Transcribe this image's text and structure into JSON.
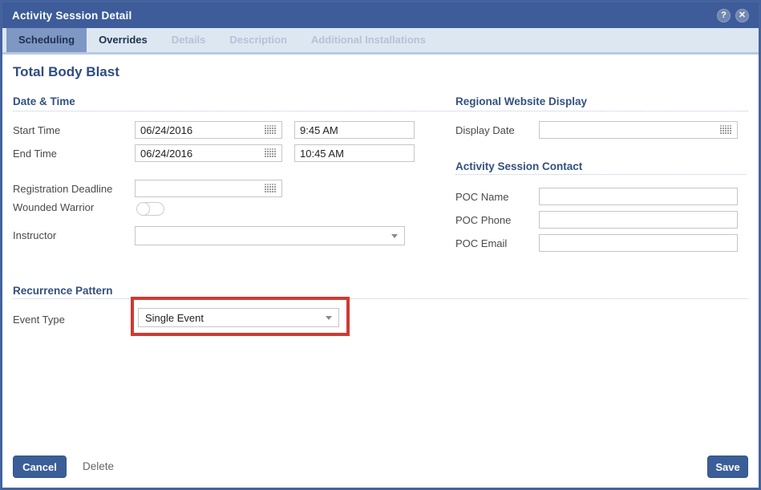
{
  "titlebar": {
    "title": "Activity Session Detail",
    "help_glyph": "?",
    "close_glyph": "✕"
  },
  "tabs": [
    {
      "label": "Scheduling",
      "state": "active"
    },
    {
      "label": "Overrides",
      "state": "enabled"
    },
    {
      "label": "Details",
      "state": "disabled"
    },
    {
      "label": "Description",
      "state": "disabled"
    },
    {
      "label": "Additional Installations",
      "state": "disabled"
    }
  ],
  "content": {
    "heading": "Total Body Blast",
    "sections": {
      "date_time": {
        "title": "Date & Time"
      },
      "regional": {
        "title": "Regional Website Display"
      },
      "contact": {
        "title": "Activity Session Contact"
      },
      "recurrence": {
        "title": "Recurrence Pattern"
      }
    },
    "fields": {
      "start_time": {
        "label": "Start Time",
        "date": "06/24/2016",
        "time": "9:45 AM"
      },
      "end_time": {
        "label": "End Time",
        "date": "06/24/2016",
        "time": "10:45 AM"
      },
      "registration_deadline": {
        "label": "Registration Deadline",
        "date": ""
      },
      "wounded_warrior": {
        "label": "Wounded Warrior",
        "state": "off"
      },
      "instructor": {
        "label": "Instructor",
        "value": ""
      },
      "display_date": {
        "label": "Display Date",
        "date": ""
      },
      "poc_name": {
        "label": "POC Name",
        "value": ""
      },
      "poc_phone": {
        "label": "POC Phone",
        "value": ""
      },
      "poc_email": {
        "label": "POC Email",
        "value": ""
      },
      "event_type": {
        "label": "Event Type",
        "value": "Single Event"
      }
    }
  },
  "footer": {
    "cancel_label": "Cancel",
    "delete_label": "Delete",
    "save_label": "Save"
  },
  "colors": {
    "titlebar_bg": "#3d5c99",
    "tabstrip_bg": "#dde7f2",
    "active_tab_bg": "#7e97c3",
    "section_heading": "#33517f",
    "annotation_red": "#cf3a32",
    "button_bg": "#3b5e98"
  }
}
